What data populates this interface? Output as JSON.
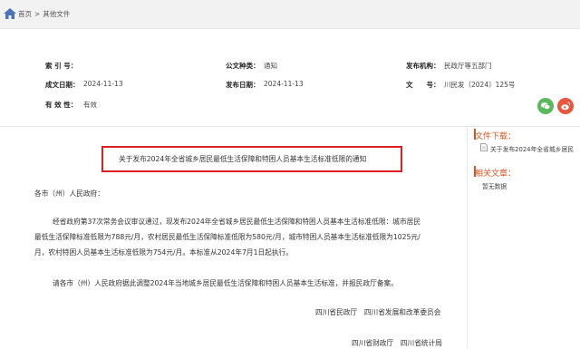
{
  "breadcrumb": {
    "home": "首页",
    "separator": ">",
    "current": "其他文件"
  },
  "meta": {
    "index_label": "索 引 号：",
    "index_value": "",
    "type_label": "公文种类：",
    "type_value": "通知",
    "issuer_label": "发布机构：",
    "issuer_value": "民政厅等五部门",
    "created_label": "成文日期：",
    "created_value": "2024-11-13",
    "published_label": "发布日期：",
    "published_value": "2024-11-13",
    "docno_label": "文　　号：",
    "docno_value": "川民发〔2024〕125号",
    "validity_label": "有 效 性：",
    "validity_value": "有效"
  },
  "share": {
    "wechat_icon": "wechat-icon",
    "weibo_icon": "weibo-icon",
    "wechat_color": "#5cb85c",
    "weibo_color": "#e8573d"
  },
  "document": {
    "title": "关于发布2024年全省城乡居民最低生活保障和特困人员基本生活标准低限的通知",
    "salutation": "各市（州）人民政府：",
    "p1_line1": "经省政府第37次常务会议审议通过，现发布2024年全省城乡居民最低生活保障和特困人员基本生活标准低限：城市居民",
    "p1_line2": "最低生活保障标准低限为788元/月，农村居民最低生活保障标准低限为580元/月，城市特困人员基本生活标准低限为1025元/",
    "p1_line3": "月，农村特困人员基本生活标准低限为754元/月。本标准从2024年7月1日起执行。",
    "p2": "请各市（州）人民政府据此调整2024年当地城乡居民最低生活保障和特困人员基本生活标准，并报民政厅备案。",
    "sign1": "四川省民政厅　四川省发展和改革委员会",
    "sign2": "四川省财政厅　四川省统计局"
  },
  "sidebar": {
    "downloads_title": "文件下载：",
    "download_item": "关于发布2024年全省城乡居民",
    "related_title": "相关文章：",
    "related_empty": "暂无数据",
    "accent_color": "#d9531e"
  }
}
